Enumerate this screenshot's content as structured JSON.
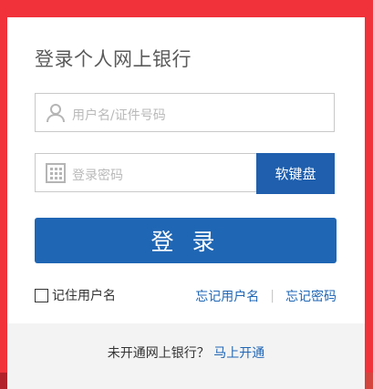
{
  "login": {
    "title": "登录个人网上银行",
    "username_placeholder": "用户名/证件号码",
    "password_placeholder": "登录密码",
    "keyboard_label": "软键盘",
    "login_label": "登 录",
    "remember_label": "记住用户名",
    "forgot_username": "忘记用户名",
    "separator": "|",
    "forgot_password": "忘记密码"
  },
  "footer": {
    "prompt": "未开通网上银行？",
    "open_link": "马上开通"
  },
  "icons": {
    "username": "user-icon",
    "password": "keypad-icon"
  },
  "colors": {
    "background": "#f1323a",
    "brand_blue": "#1f66b4"
  }
}
